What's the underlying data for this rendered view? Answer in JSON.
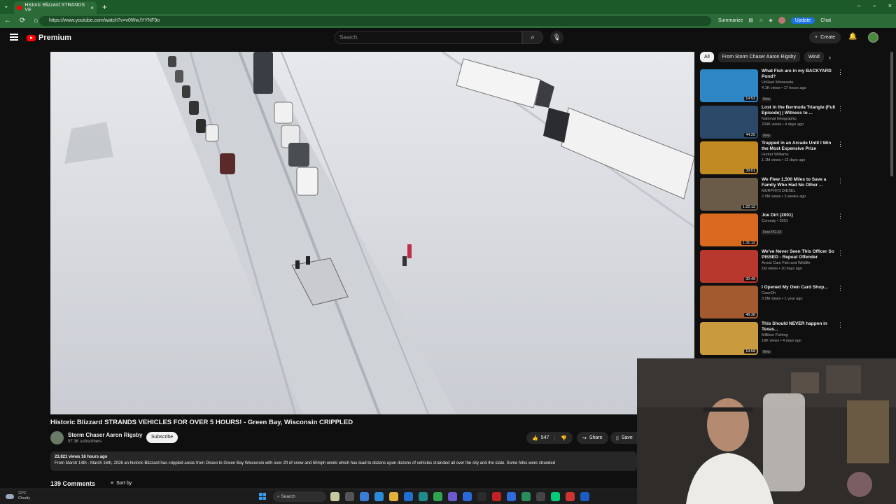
{
  "browser": {
    "tab_title": "Historic Blizzard STRANDS VE",
    "url": "https://www.youtube.com/watch?v=v0Ww.lYYNF9o",
    "summarize": "Summarize",
    "update": "Update",
    "chat": "Chat"
  },
  "masthead": {
    "logo": "Premium",
    "search_placeholder": "Search",
    "create": "Create"
  },
  "video": {
    "title": "Historic Blizzard STRANDS VEHICLES FOR OVER 5 HOURS! - Green Bay, Wisconsin CRIPPLED",
    "channel": "Storm Chaser Aaron Rigsby",
    "subscribers": "57.3K subscribers",
    "subscribe": "Subscribe",
    "likes": "547",
    "share": "Share",
    "save": "Save",
    "desc_meta": "23,821 views  16 hours ago",
    "description": "From March 14th - March 16th, 2026 an historic Blizzard has crippled areas from Osseo to Green Bay Wisconsin with over 2ft of snow and 50mph winds which has lead to dozens upon dozens of vehicles stranded all over the city and the state. Some folks were stranded",
    "comments": "139 Comments",
    "sort": "Sort by"
  },
  "chips": [
    "All",
    "From Storm Chaser Aaron Rigsby",
    "Wind"
  ],
  "recommendations": [
    {
      "title": "What Fish are in my BACKYARD Pond?",
      "channel": "UnReel Minnesota",
      "meta": "4.1K views • 17 hours ago",
      "badge": "New",
      "duration": "14:52",
      "thumb": "#2f86c4"
    },
    {
      "title": "Lost in the Bermuda Triangle (Full Episode) | Witness to ...",
      "channel": "National Geographic",
      "meta": "234K views • 4 days ago",
      "badge": "New",
      "duration": "44:25",
      "thumb": "#2b4a6a"
    },
    {
      "title": "Trapped in an Arcade Until I Win the Most Expensive Prize",
      "channel": "Hunter Williams",
      "meta": "1.1M views • 12 days ago",
      "badge": "",
      "duration": "39:01",
      "thumb": "#c28a22"
    },
    {
      "title": "We Flew 1,500 Miles to Save a Family Who Had No Other ...",
      "channel": "MURPHYS DIESEL",
      "meta": "2.9M views • 3 weeks ago",
      "badge": "",
      "duration": "1:22:13",
      "thumb": "#6a5a48"
    },
    {
      "title": "Joe Dirt (2001)",
      "channel": "Comedy • 2001",
      "meta": "",
      "badge": "Free  PG-13",
      "duration": "1:31:12",
      "thumb": "#d9691e"
    },
    {
      "title": "We've Never Seen This Officer So PISSED - Repeat Offender",
      "channel": "Arrest Cam Fish and Wildlife",
      "meta": "1M views • 10 days ago",
      "badge": "",
      "duration": "30:49",
      "thumb": "#b8382e"
    },
    {
      "title": "I Opened My Own Card Shop...",
      "channel": "CaseOh",
      "meta": "3.5M views • 1 year ago",
      "badge": "",
      "duration": "48:38",
      "thumb": "#a35a2e"
    },
    {
      "title": "This Should NEVER happen in Texas...",
      "channel": "Milliken Fishing",
      "meta": "18K views • 4 days ago",
      "badge": "New",
      "duration": "19:58",
      "thumb": "#c99a3e"
    }
  ],
  "taskbar": {
    "temp": "22°F",
    "condition": "Cloudy",
    "search": "Search",
    "icon_colors": [
      "#c9c9a0",
      "#555",
      "#3a7bd5",
      "#2a8cd8",
      "#e4b23c",
      "#1e6fd0",
      "#1f8a8a",
      "#2fa44f",
      "#6b5bd0",
      "#2a6ad8",
      "#2c2c2c",
      "#c32222",
      "#2d6cd8",
      "#2a8c5a",
      "#444",
      "#0c7",
      "#c33",
      "#1a5cc0"
    ]
  }
}
